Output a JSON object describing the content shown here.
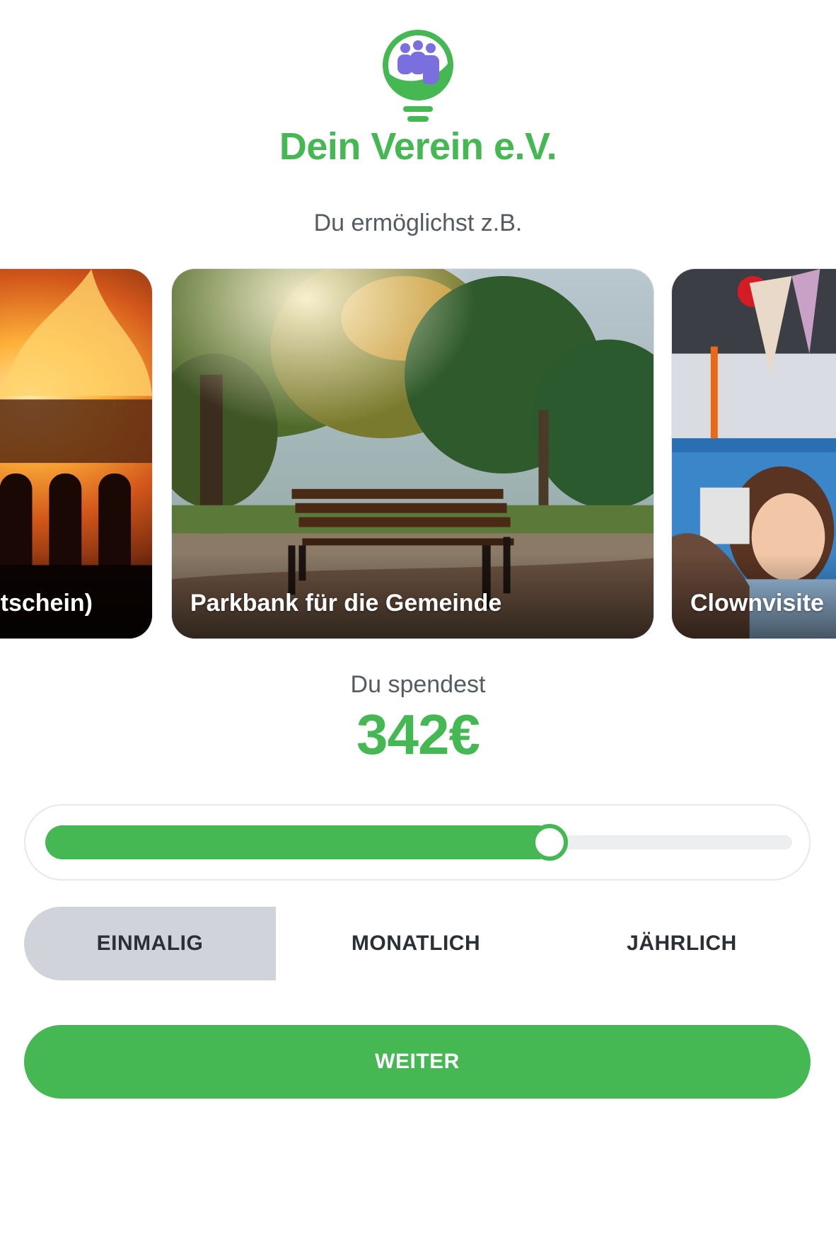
{
  "header": {
    "org_name": "Dein Verein e.V.",
    "logo_icon": "lightbulb-people-logo"
  },
  "intro": {
    "text": "Du ermöglichst z.B."
  },
  "carousel": {
    "cards": [
      {
        "label": "tschein)",
        "image": "campfire-photo"
      },
      {
        "label": "Parkbank für die Gemeinde",
        "image": "park-bench-photo"
      },
      {
        "label": "Clownvisite",
        "image": "clown-visit-photo"
      }
    ]
  },
  "donation": {
    "label": "Du spendest",
    "amount": "342€"
  },
  "slider": {
    "fraction": 0.675
  },
  "frequency": {
    "options": [
      {
        "label": "EINMALIG",
        "selected": true
      },
      {
        "label": "MONATLICH",
        "selected": false
      },
      {
        "label": "JÄHRLICH",
        "selected": false
      }
    ]
  },
  "actions": {
    "next_label": "WEITER"
  },
  "colors": {
    "accent": "#45b853",
    "logo_people": "#7b6fe0",
    "segment_active": "#d0d3da",
    "text_muted": "#555b63"
  }
}
